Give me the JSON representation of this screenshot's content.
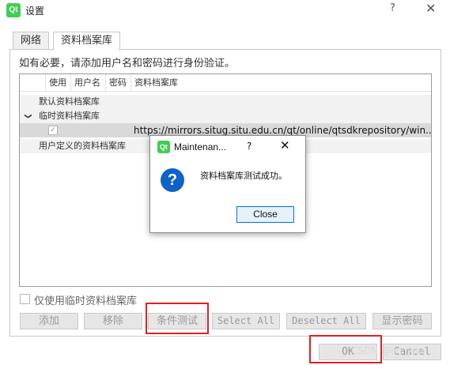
{
  "window": {
    "title": "设置",
    "logo": "Qt",
    "help_glyph": "?",
    "close_glyph": "✕"
  },
  "tabs": [
    {
      "label": "网络"
    },
    {
      "label": "资料档案库",
      "active": true
    }
  ],
  "instruction": "如有必要，请添加用户名和密码进行身份验证。",
  "tree": {
    "columns": [
      "使用",
      "用户名",
      "密码",
      "资料档案库"
    ],
    "rows": {
      "default": "默认资料档案库",
      "temporary": "临时资料档案库",
      "temporary_url": "https://mirrors.situg.situ.edu.cn/qt/online/qtsdkrepository/win...",
      "user_defined": "用户定义的资料档案库"
    },
    "expand_glyph": "❯",
    "check_glyph": "✓"
  },
  "options": {
    "use_temp_only": "仅使用临时资料档案库"
  },
  "buttons": {
    "add": "添加",
    "remove": "移除",
    "test": "条件测试",
    "select_all": "Select All",
    "deselect_all": "Deselect All",
    "show_password": "显示密码",
    "ok": "OK",
    "cancel": "Cancel"
  },
  "watermark": "CSDN @lin_you",
  "dialog": {
    "logo": "Qt",
    "title": "Maintenan...",
    "help_glyph": "?",
    "close_glyph": "✕",
    "icon": "?",
    "message": "资料档案库测试成功。",
    "close_label": "Close"
  },
  "colors": {
    "accent": "#0078d7",
    "highlight": "#e02020",
    "qt_green": "#41cd52",
    "info_icon": "#0e62c8"
  }
}
